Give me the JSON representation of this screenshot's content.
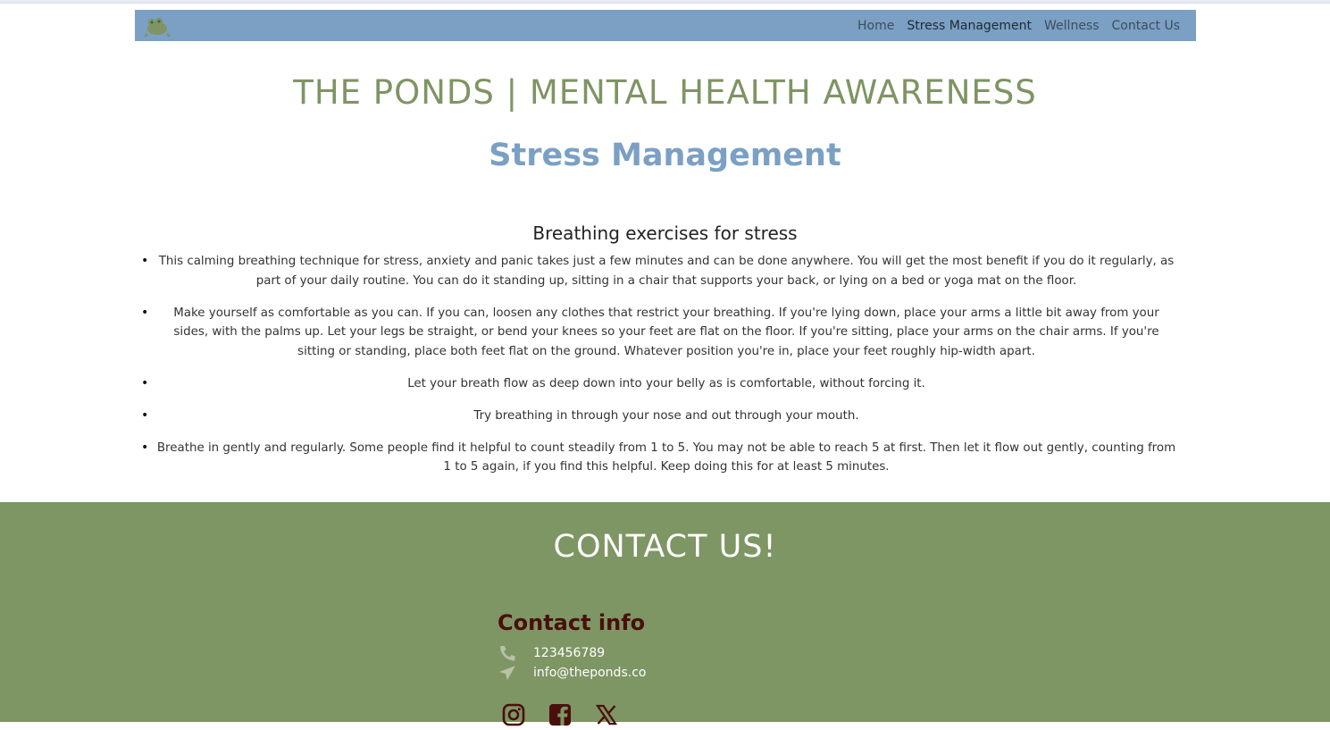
{
  "nav": {
    "logo_icon": "frog-icon",
    "items": [
      {
        "label": "Home",
        "active": false
      },
      {
        "label": "Stress Management",
        "active": true
      },
      {
        "label": "Wellness",
        "active": false
      },
      {
        "label": "Contact Us",
        "active": false
      }
    ]
  },
  "header": {
    "site_title": "THE PONDS | MENTAL HEALTH AWARENESS",
    "page_title": "Stress Management"
  },
  "main": {
    "section_heading": "Breathing exercises for stress",
    "tips": [
      "This calming breathing technique for stress, anxiety and panic takes just a few minutes and can be done anywhere. You will get the most benefit if you do it regularly, as part of your daily routine. You can do it standing up, sitting in a chair that supports your back, or lying on a bed or yoga mat on the floor.",
      "Make yourself as comfortable as you can. If you can, loosen any clothes that restrict your breathing. If you're lying down, place your arms a little bit away from your sides, with the palms up. Let your legs be straight, or bend your knees so your feet are flat on the floor. If you're sitting, place your arms on the chair arms. If you're sitting or standing, place both feet flat on the ground. Whatever position you're in, place your feet roughly hip-width apart.",
      "Let your breath flow as deep down into your belly as is comfortable, without forcing it.",
      "Try breathing in through your nose and out through your mouth.",
      "Breathe in gently and regularly. Some people find it helpful to count steadily from 1 to 5. You may not be able to reach 5 at first. Then let it flow out gently, counting from 1 to 5 again, if you find this helpful. Keep doing this for at least 5 minutes."
    ]
  },
  "footer": {
    "heading": "CONTACT US!",
    "contact_info_heading": "Contact info",
    "phone": "123456789",
    "email": "info@theponds.co",
    "social_icons": [
      "instagram-icon",
      "facebook-icon",
      "x-icon"
    ]
  },
  "colors": {
    "nav_bg": "#7ba0c4",
    "title_green": "#7f9464",
    "page_title_blue": "#7ba0c4",
    "footer_bg": "#7e9564",
    "contact_info_heading": "#4a0f0c"
  }
}
